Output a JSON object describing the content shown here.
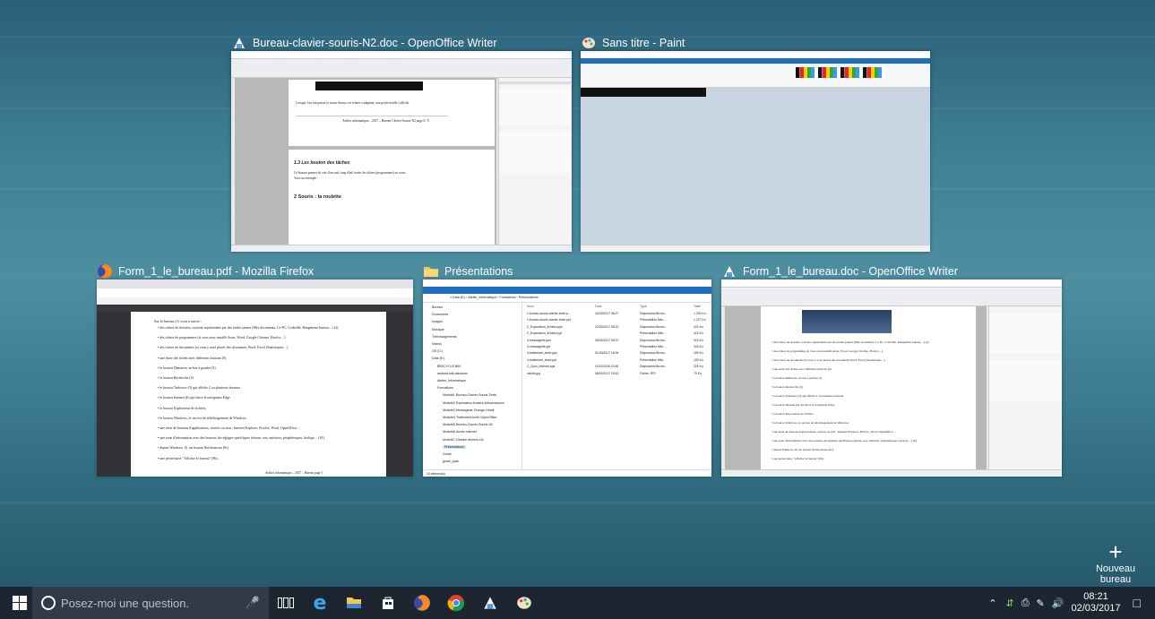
{
  "desktop": {
    "new_desktop_label": "Nouveau bureau"
  },
  "windows": [
    {
      "title": "Bureau-clavier-souris-N2.doc - OpenOffice Writer",
      "icon": "openoffice-writer-icon"
    },
    {
      "title": "Sans titre - Paint",
      "icon": "paint-icon"
    },
    {
      "title": "Form_1_le_bureau.pdf - Mozilla Firefox",
      "icon": "firefox-icon"
    },
    {
      "title": "Présentations",
      "icon": "folder-icon"
    },
    {
      "title": "Form_1_le_bureau.doc - OpenOffice Writer",
      "icon": "openoffice-writer-icon"
    }
  ],
  "writer1": {
    "heading1": "1.3   Les bouton des tâches",
    "heading2": "2   Souris : la roulette",
    "footer": "Atelier informatique – 2017 – Bureau-Clavier-Souris-N2   page 6 / 9"
  },
  "explorer": {
    "path": "« Data (E:) › Atelier_informatique › Formations › Présentations",
    "columns": [
      "Nom",
      "Date",
      "Type",
      "Taille"
    ],
    "files": [
      {
        "name": "1-bureau-souris-clavier-texte.p...",
        "date": "16/02/2017 08:27",
        "type": "Diaporama Micros...",
        "size": "1 250 Ko"
      },
      {
        "name": "1-bureau-souris-clavier-texte.ppt",
        "date": "",
        "type": "Présentation Micr...",
        "size": "1 227 Ko"
      },
      {
        "name": "2_Exploration_fichiers.pps",
        "date": "22/02/2017 08:22",
        "type": "Diaporama Micros...",
        "size": "420 Ko"
      },
      {
        "name": "2_Exploration_fichiers.ppt",
        "date": "",
        "type": "Présentation Micr...",
        "size": "420 Ko"
      },
      {
        "name": "3-messagerie.pps",
        "date": "26/02/2017 08:37",
        "type": "Diaporama Micros...",
        "size": "320 Ko"
      },
      {
        "name": "3-messagerie.ppt",
        "date": "",
        "type": "Présentation Micr...",
        "size": "320 Ko"
      },
      {
        "name": "4-traitement_texte.pps",
        "date": "01/03/2017 18:04",
        "type": "Diaporama Micros...",
        "size": "150 Ko"
      },
      {
        "name": "4-traitement_texte.ppt",
        "date": "",
        "type": "Présentation Micr...",
        "size": "150 Ko"
      },
      {
        "name": "C_Quoi_Internet.pps",
        "date": "21/11/2016 10:45",
        "type": "Diaporama Micros...",
        "size": "225 Ko"
      },
      {
        "name": "clavier.jpg",
        "date": "08/02/2017 15:42",
        "type": "Fichier JPG",
        "size": "75 Ko"
      }
    ],
    "tree": [
      "Bureau",
      "Documents",
      "Images",
      "Musique",
      "Téléchargements",
      "Vidéos",
      "OS (C:)",
      "Data (E:)",
      "$RECYCLE.BIN",
      "android-sdk-windows",
      "Atelier_informatique",
      "Formations",
      "Module1-Bureau-Clavier-Souris-Texte",
      "Module2-Exploration-fichiers-Arborescence",
      "Module3-Messagerie-Orange-Gmail",
      "Module4-Traitement-texte-OpenOffice",
      "Module5-Bureau-Clavier-Souris-N2",
      "Module6-Accès internet",
      "Module7-Gestion-fichiers-N2",
      "Présentations",
      "Gmail",
      "gmail_pplis"
    ],
    "status": "10 élément(s)"
  },
  "firefox": {
    "intro": "Sur le bureau (1) vous trouvez :",
    "items": [
      "des icônes de dossiers, souvent représentées par des fardes jaunes (Mes documents, Ce PC, Corbeille, Rangement bureau…) (2)",
      "des icônes de programmes (si vous avez installé Avast, Word, Google Chrome, Firefox…)",
      "des icônes de documents (si vous y avez placés des documents Word, Excel (Statistiques…)",
      "une barre des tâches avec différents boutons (9)",
      "le bouton Démarrer, en bas à gauche (3)",
      "le bouton Recherche (4)",
      "le bouton Taskview (5) qui affiche 2 ou plusieurs bureaux",
      "le bouton Internet (6) qui lance le navigateur Edge",
      "le bouton Explorateur de fichiers",
      "le bouton Windows, le service de téléchargement de Windows",
      "une série de boutons d'applications, ouverts ou non : Internet Explorer, Firefox, Word, OpenOffice…",
      "une zone d'information avec des boutons de réglages spécifiques (réseau, son, antivirus, périphériques, horloge…) (9)",
      "depuis Windows 10, un bouton Notifications (9c)",
      "une petite barre \"Afficher le bureau\" (9b)."
    ],
    "footer": "Atelier informatique – 2017 – Bureau page 1"
  },
  "taskbar": {
    "search_placeholder": "Posez-moi une question.",
    "time": "08:21",
    "date": "02/03/2017"
  }
}
